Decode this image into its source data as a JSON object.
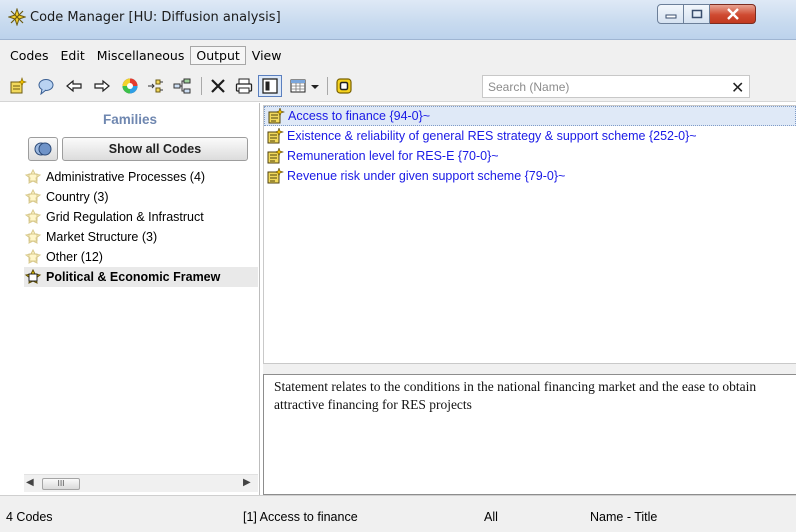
{
  "window": {
    "title": "Code Manager [HU: Diffusion analysis]",
    "buttons": {
      "minimize": "minimize",
      "maximize": "maximize",
      "close": "close"
    }
  },
  "menu": {
    "items": [
      {
        "label": "Codes"
      },
      {
        "label": "Edit"
      },
      {
        "label": "Miscellaneous"
      },
      {
        "label": "Output",
        "active": true
      },
      {
        "label": "View"
      }
    ]
  },
  "toolbar": {
    "icons": [
      "new-code-icon",
      "comment-icon",
      "back-arrow-icon",
      "forward-arrow-icon",
      "color-wheel-icon",
      "merge-icon",
      "network-icon",
      "delete-icon",
      "print-icon",
      "single-pane-view-icon",
      "table-view-icon",
      "filter-icon"
    ],
    "search": {
      "placeholder": "Search (Name)",
      "value": "",
      "clear_label": "✕"
    }
  },
  "families": {
    "title": "Families",
    "show_all_label": "Show all Codes",
    "items": [
      {
        "label": "Administrative Processes (4)",
        "selected": false
      },
      {
        "label": "Country (3)",
        "selected": false
      },
      {
        "label": "Grid Regulation & Infrastruct",
        "selected": false
      },
      {
        "label": "Market Structure (3)",
        "selected": false
      },
      {
        "label": "Other (12)",
        "selected": false
      },
      {
        "label": "Political & Economic Framew",
        "selected": true
      }
    ],
    "scrollbar": {
      "thumb_label": "III"
    }
  },
  "codes": {
    "items": [
      {
        "label": "Access to finance {94-0}~",
        "selected": true
      },
      {
        "label": "Existence & reliability of general RES strategy & support scheme {252-0}~",
        "selected": false
      },
      {
        "label": "Remuneration level for RES-E {70-0}~",
        "selected": false
      },
      {
        "label": "Revenue risk under given support scheme {79-0}~",
        "selected": false
      }
    ]
  },
  "comment": {
    "text": "Statement relates to the conditions in the national financing market and the ease to obtain attractive financing for RES projects"
  },
  "status": {
    "count": "4 Codes",
    "selected": "[1] Access to finance",
    "filter": "All",
    "sort": "Name - Title"
  },
  "colors": {
    "code_text": "#1a1ae6",
    "families_title": "#6f87b0",
    "selection_bg": "#dfe9f7",
    "close_button": "#cf4a31"
  }
}
